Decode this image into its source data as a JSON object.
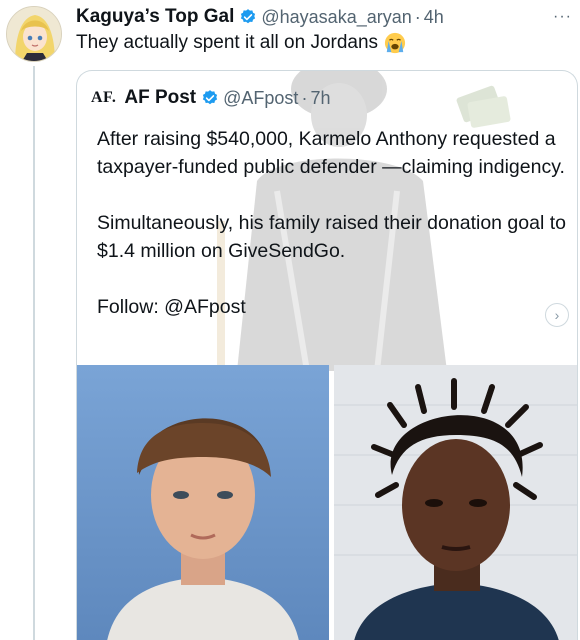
{
  "tweet": {
    "author_name": "Kaguya’s Top Gal",
    "handle": "@hayasaka_aryan",
    "separator": "·",
    "time": "4h",
    "text": "They actually spent it all on Jordans",
    "emoji": "loudly-crying-face",
    "more": "···"
  },
  "quote": {
    "logo": "AF.",
    "author_name": "AF Post",
    "handle": "@AFpost",
    "separator": "·",
    "time": "7h",
    "paragraph1": "After raising $540,000, Karmelo Anthony requested a taxpayer-funded public defender —claiming indigency.",
    "paragraph2": "Simultaneously, his family raised their donation goal to $1.4 million on GiveSendGo.",
    "paragraph3": "Follow: @AFpost",
    "carousel_next": "›"
  },
  "colors": {
    "verified": "#1d9bf0",
    "secondary_text": "#536471",
    "border": "#cfd9de"
  }
}
